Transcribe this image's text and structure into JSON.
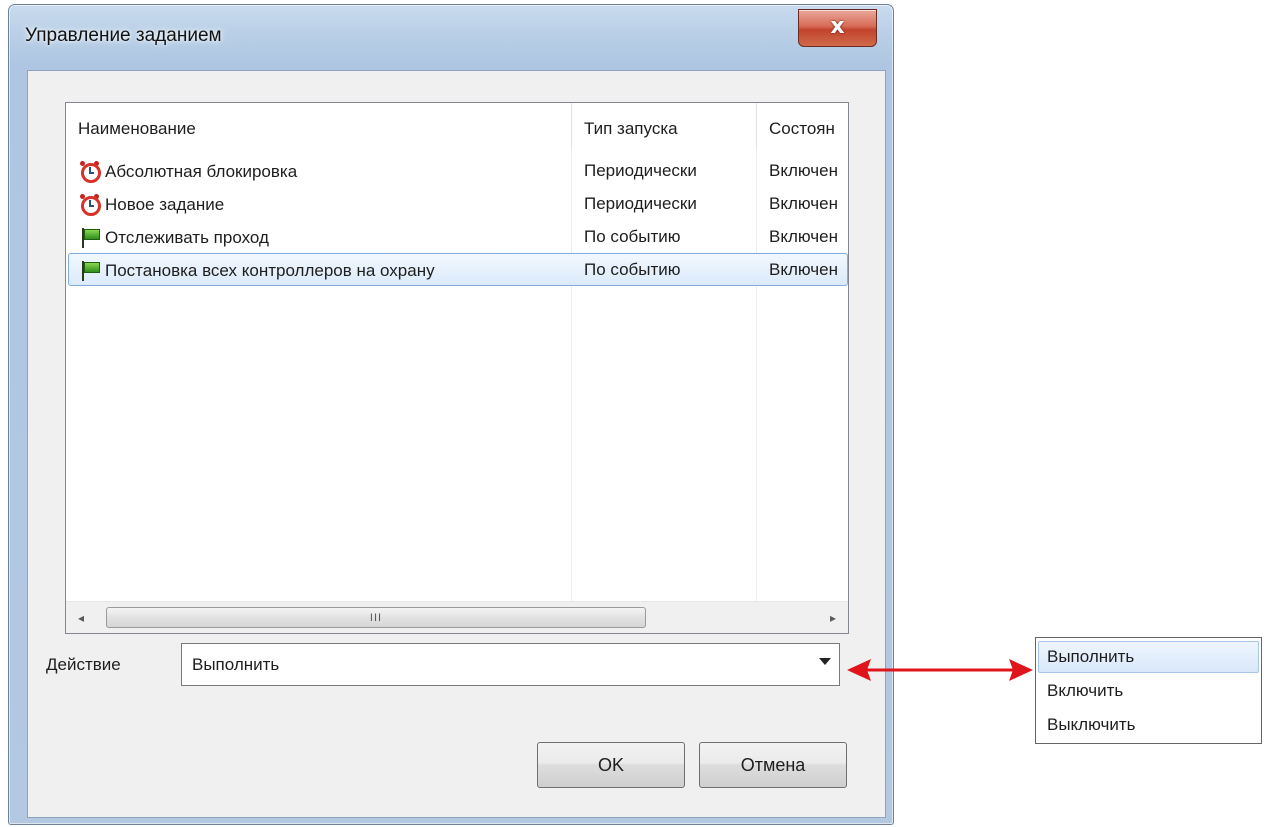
{
  "window": {
    "title": "Управление заданием",
    "close_label": "x"
  },
  "list": {
    "columns": [
      "Наименование",
      "Тип запуска",
      "Состоян"
    ],
    "rows": [
      {
        "icon": "alarm-clock-icon",
        "name": "Абсолютная блокировка",
        "launch_type": "Периодически",
        "state": "Включен"
      },
      {
        "icon": "alarm-clock-icon",
        "name": "Новое задание",
        "launch_type": "Периодически",
        "state": "Включен"
      },
      {
        "icon": "green-flag-icon",
        "name": "Отслеживать проход",
        "launch_type": "По событию",
        "state": "Включен"
      },
      {
        "icon": "green-flag-icon",
        "name": "Постановка всех контроллеров на охрану",
        "launch_type": "По событию",
        "state": "Включен"
      }
    ],
    "selected_row": 4,
    "scrollbar": {
      "left_arrow": "◂",
      "thumb_grip": "III",
      "right_arrow": "▸"
    }
  },
  "action": {
    "label": "Действие",
    "value": "Выполнить"
  },
  "buttons": {
    "ok": "OK",
    "cancel": "Отмена"
  },
  "dropdown_options": [
    "Выполнить",
    "Включить",
    "Выключить"
  ],
  "colors": {
    "arrow": "#e0141b",
    "selection": "#dbeafb"
  }
}
